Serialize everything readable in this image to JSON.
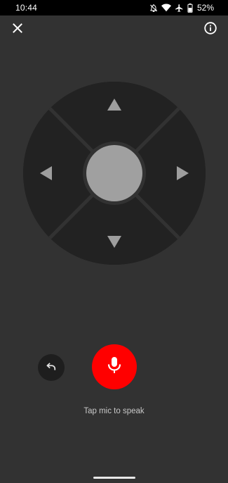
{
  "status_bar": {
    "time": "10:44",
    "battery_percent": "52%",
    "icons": [
      "notifications-off-icon",
      "wifi-icon",
      "airplane-icon",
      "battery-icon"
    ]
  },
  "toolbar": {
    "close_icon": "close-icon",
    "info_icon": "info-icon"
  },
  "dpad": {
    "directions": [
      "up",
      "right",
      "down",
      "left"
    ],
    "center": "select"
  },
  "controls": {
    "back_icon": "undo-icon",
    "mic_icon": "mic-icon",
    "mic_color": "#ff0000",
    "hint": "Tap mic to speak"
  },
  "colors": {
    "background": "#323232",
    "dpad_surface": "#222222",
    "dpad_center": "#a0a0a0",
    "arrow": "#9e9e9e"
  }
}
